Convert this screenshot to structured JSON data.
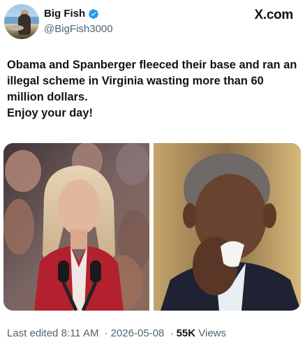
{
  "author": {
    "display_name": "Big Fish",
    "handle": "@BigFish3000",
    "verified": true,
    "avatar_icon": "avatar-photo"
  },
  "source_label": "X.com",
  "tweet": {
    "text": "Obama and Spanberger fleeced their base and ran an illegal scheme in Virginia wasting more than 60 million dollars.\nEnjoy your day!"
  },
  "media": {
    "count": 2
  },
  "meta": {
    "edited_label": "Last edited",
    "time": "8:11 AM",
    "date": "2026-05-08",
    "separator": "·",
    "views_count": "55K",
    "views_label": "Views"
  },
  "colors": {
    "text": "#0f1419",
    "muted": "#536471",
    "verified_blue": "#1d9bf0"
  }
}
